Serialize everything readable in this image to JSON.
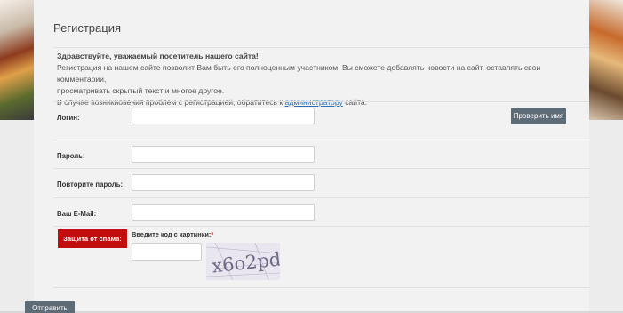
{
  "page": {
    "title": "Регистрация"
  },
  "info": {
    "greeting": "Здравствуйте, уважаемый посетитель нашего сайта!",
    "text1": "Регистрация на нашем сайте позволит Вам быть его полноценным участником. Вы сможете добавлять новости на сайт, оставлять свои комментарии,",
    "text2": "просматривать скрытый текст и многое другое.",
    "text3_before": "В случае возникновения проблем с регистрацией, обратитесь к ",
    "text3_link": "администратору",
    "text3_after": " сайта."
  },
  "form": {
    "login_label": "Логин:",
    "login_value": "",
    "check_name_button": "Проверить имя",
    "password_label": "Пароль:",
    "password_value": "",
    "repeat_password_label": "Повторите пароль:",
    "repeat_password_value": "",
    "email_label": "Ваш E-Mail:",
    "email_value": "",
    "spam_protection_label": "Защита от спама:",
    "captcha_prompt": "Введите код с картинки:",
    "captcha_required_mark": "*",
    "captcha_value": "",
    "captcha_image_text": "x6o2pd",
    "submit_button": "Отправить"
  },
  "colors": {
    "accent_button": "#5e6c78",
    "spam_red": "#c10d0d",
    "link": "#2a6fb7"
  }
}
